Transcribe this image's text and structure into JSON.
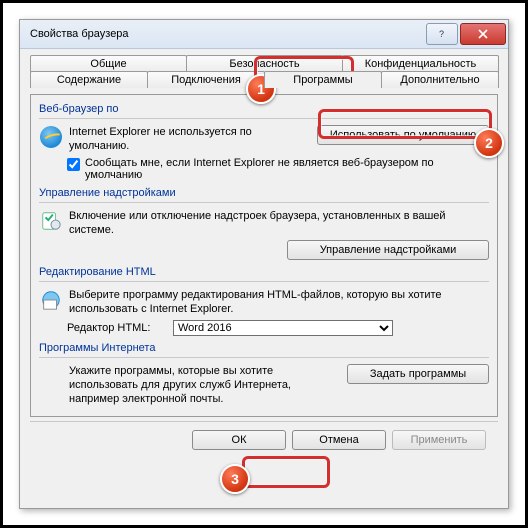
{
  "title": "Свойства браузера",
  "tabs": {
    "row1": [
      "Общие",
      "Безопасность",
      "Конфиденциальность"
    ],
    "row2": [
      "Содержание",
      "Подключения",
      "Программы",
      "Дополнительно"
    ],
    "active": "Программы"
  },
  "browser": {
    "group": "Веб-браузер по",
    "msg": "Internet Explorer не используется по умолчанию.",
    "btn": "Использовать по умолчанию",
    "check": "Сообщать мне, если Internet Explorer не является веб-браузером по умолчанию"
  },
  "addons": {
    "group": "Управление надстройками",
    "msg": "Включение или отключение надстроек браузера, установленных в вашей системе.",
    "btn": "Управление надстройками"
  },
  "html": {
    "group": "Редактирование HTML",
    "msg": "Выберите программу редактирования HTML-файлов, которую вы хотите использовать с Internet Explorer.",
    "label": "Редактор HTML:",
    "value": "Word 2016"
  },
  "progs": {
    "group": "Программы Интернета",
    "msg": "Укажите программы, которые вы хотите использовать для других служб Интернета, например электронной почты.",
    "btn": "Задать программы"
  },
  "buttons": {
    "ok": "ОК",
    "cancel": "Отмена",
    "apply": "Применить"
  },
  "badges": {
    "1": "1",
    "2": "2",
    "3": "3"
  }
}
